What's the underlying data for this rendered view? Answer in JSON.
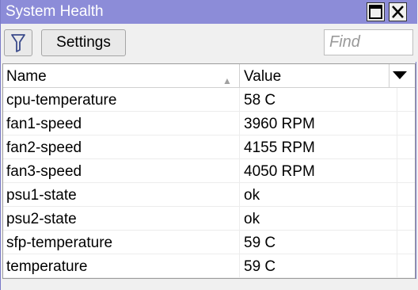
{
  "window": {
    "title": "System Health",
    "maximize_icon": "maximize-icon",
    "close_icon": "close-icon"
  },
  "toolbar": {
    "filter_icon": "filter-icon",
    "settings_label": "Settings",
    "find_placeholder": "Find"
  },
  "table": {
    "columns": [
      {
        "label": "Name"
      },
      {
        "label": "Value"
      }
    ],
    "rows": [
      {
        "name": "cpu-temperature",
        "value": "58 C"
      },
      {
        "name": "fan1-speed",
        "value": "3960 RPM"
      },
      {
        "name": "fan2-speed",
        "value": "4155 RPM"
      },
      {
        "name": "fan3-speed",
        "value": "4050 RPM"
      },
      {
        "name": "psu1-state",
        "value": "ok"
      },
      {
        "name": "psu2-state",
        "value": "ok"
      },
      {
        "name": "sfp-temperature",
        "value": "59 C"
      },
      {
        "name": "temperature",
        "value": "59 C"
      }
    ]
  }
}
